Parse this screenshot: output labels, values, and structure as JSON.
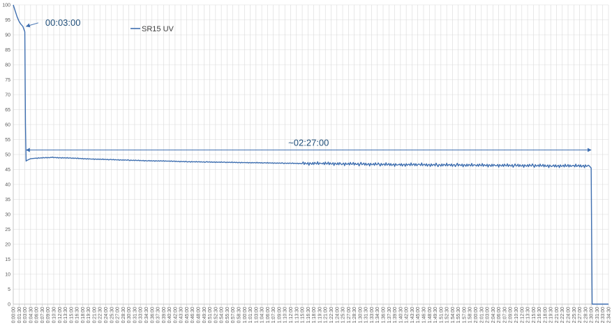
{
  "chart_data": {
    "type": "line",
    "title": "",
    "xlabel": "",
    "ylabel": "",
    "ylim": [
      0,
      100
    ],
    "y_ticks": [
      0,
      5,
      10,
      15,
      20,
      25,
      30,
      35,
      40,
      45,
      50,
      55,
      60,
      65,
      70,
      75,
      80,
      85,
      90,
      95,
      100
    ],
    "x_label_start": "0:00:00",
    "x_label_step_seconds": 90,
    "x_label_end": "2:34:30",
    "grid": true,
    "legend": {
      "position": "top-center"
    },
    "colors": {
      "series": "#3f6fb0",
      "grid": "#d9d9d9",
      "axis": "#bfbfbf",
      "text": "#595959",
      "annotation": "#1f4e79"
    },
    "series": [
      {
        "name": "SR15 UV",
        "points": [
          [
            "0:00:00",
            100
          ],
          [
            "0:00:30",
            98
          ],
          [
            "0:01:00",
            96
          ],
          [
            "0:01:30",
            94.5
          ],
          [
            "0:02:00",
            93.5
          ],
          [
            "0:02:30",
            92.8
          ],
          [
            "0:03:00",
            91
          ],
          [
            "0:03:10",
            60
          ],
          [
            "0:03:20",
            47.8
          ],
          [
            "0:03:30",
            48
          ],
          [
            "0:04:30",
            48.6
          ],
          [
            "0:06:00",
            48.8
          ],
          [
            "0:10:00",
            49
          ],
          [
            "0:15:00",
            48.8
          ],
          [
            "0:20:00",
            48.5
          ],
          [
            "0:25:00",
            48.3
          ],
          [
            "0:30:00",
            48.1
          ],
          [
            "0:35:00",
            47.9
          ],
          [
            "0:40:00",
            47.8
          ],
          [
            "0:45:00",
            47.6
          ],
          [
            "0:50:00",
            47.5
          ],
          [
            "0:55:00",
            47.4
          ],
          [
            "1:00:00",
            47.3
          ],
          [
            "1:05:00",
            47.2
          ],
          [
            "1:10:00",
            47.1
          ],
          [
            "1:15:00",
            47
          ],
          [
            "1:20:00",
            47
          ],
          [
            "1:25:00",
            46.9
          ],
          [
            "1:30:00",
            46.8
          ],
          [
            "1:35:00",
            46.7
          ],
          [
            "1:40:00",
            46.6
          ],
          [
            "1:45:00",
            46.6
          ],
          [
            "1:50:00",
            46.5
          ],
          [
            "1:55:00",
            46.5
          ],
          [
            "2:00:00",
            46.4
          ],
          [
            "2:05:00",
            46.4
          ],
          [
            "2:10:00",
            46.3
          ],
          [
            "2:15:00",
            46.3
          ],
          [
            "2:20:00",
            46.2
          ],
          [
            "2:25:00",
            46.2
          ],
          [
            "2:29:30",
            46.2
          ],
          [
            "2:30:00",
            45.5
          ],
          [
            "2:30:15",
            0
          ],
          [
            "2:34:30",
            0
          ]
        ],
        "noise_amplitude_after": [
          "1:15:00",
          0.6
        ]
      }
    ],
    "annotations": [
      {
        "text": "00:03:00",
        "type": "arrow",
        "from": [
          "0:06:30",
          94
        ],
        "to": [
          "0:03:20",
          92.8
        ]
      },
      {
        "text": "~02:27:00",
        "type": "double-arrow",
        "from": [
          "0:03:20",
          51.5
        ],
        "to": [
          "2:30:00",
          51.5
        ]
      }
    ]
  }
}
